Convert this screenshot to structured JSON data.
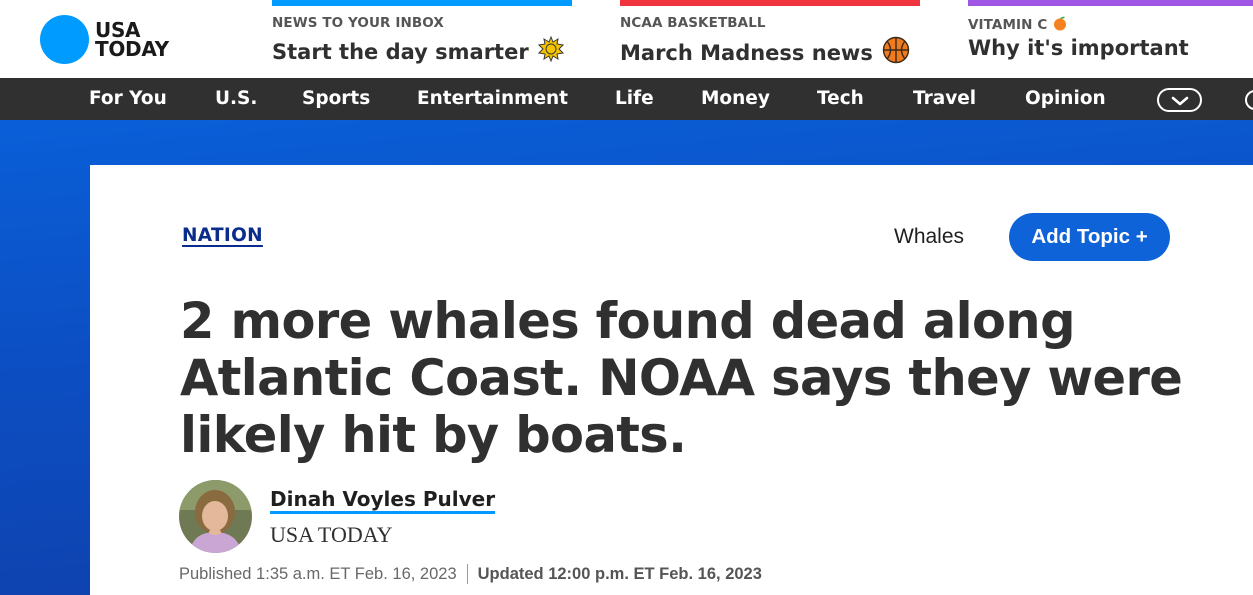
{
  "header": {
    "logo": {
      "line1": "USA",
      "line2": "TODAY",
      "color": "#009bff"
    },
    "promos": [
      {
        "kicker": "NEWS TO YOUR INBOX",
        "headline": "Start the day smarter",
        "emoji": "☀",
        "accent": "#009bff"
      },
      {
        "kicker": "NCAA BASKETBALL",
        "headline": "March Madness news",
        "emoji": "🏀",
        "accent": "#f0343d"
      },
      {
        "kicker": "VITAMIN C",
        "kicker_emoji": "🍊",
        "headline": "Why it's important",
        "accent": "#9f57e3"
      }
    ]
  },
  "nav": {
    "items": [
      "For You",
      "U.S.",
      "Sports",
      "Entertainment",
      "Life",
      "Money",
      "Tech",
      "Travel",
      "Opinion"
    ],
    "more_icon": "chevron-down-icon"
  },
  "article": {
    "section": "NATION",
    "topic": "Whales",
    "add_topic_label": "Add Topic +",
    "title": "2 more whales found dead along Atlantic Coast. NOAA says they were likely hit by boats.",
    "author": "Dinah Voyles Pulver",
    "outlet": "USA TODAY",
    "published": "Published 1:35 a.m. ET Feb. 16, 2023",
    "updated": "Updated 12:00 p.m. ET Feb. 16, 2023"
  },
  "colors": {
    "brand_blue": "#009bff",
    "nav_bg": "#303030",
    "band_blue": "#0c4fc4",
    "button_blue": "#0f63d8"
  }
}
